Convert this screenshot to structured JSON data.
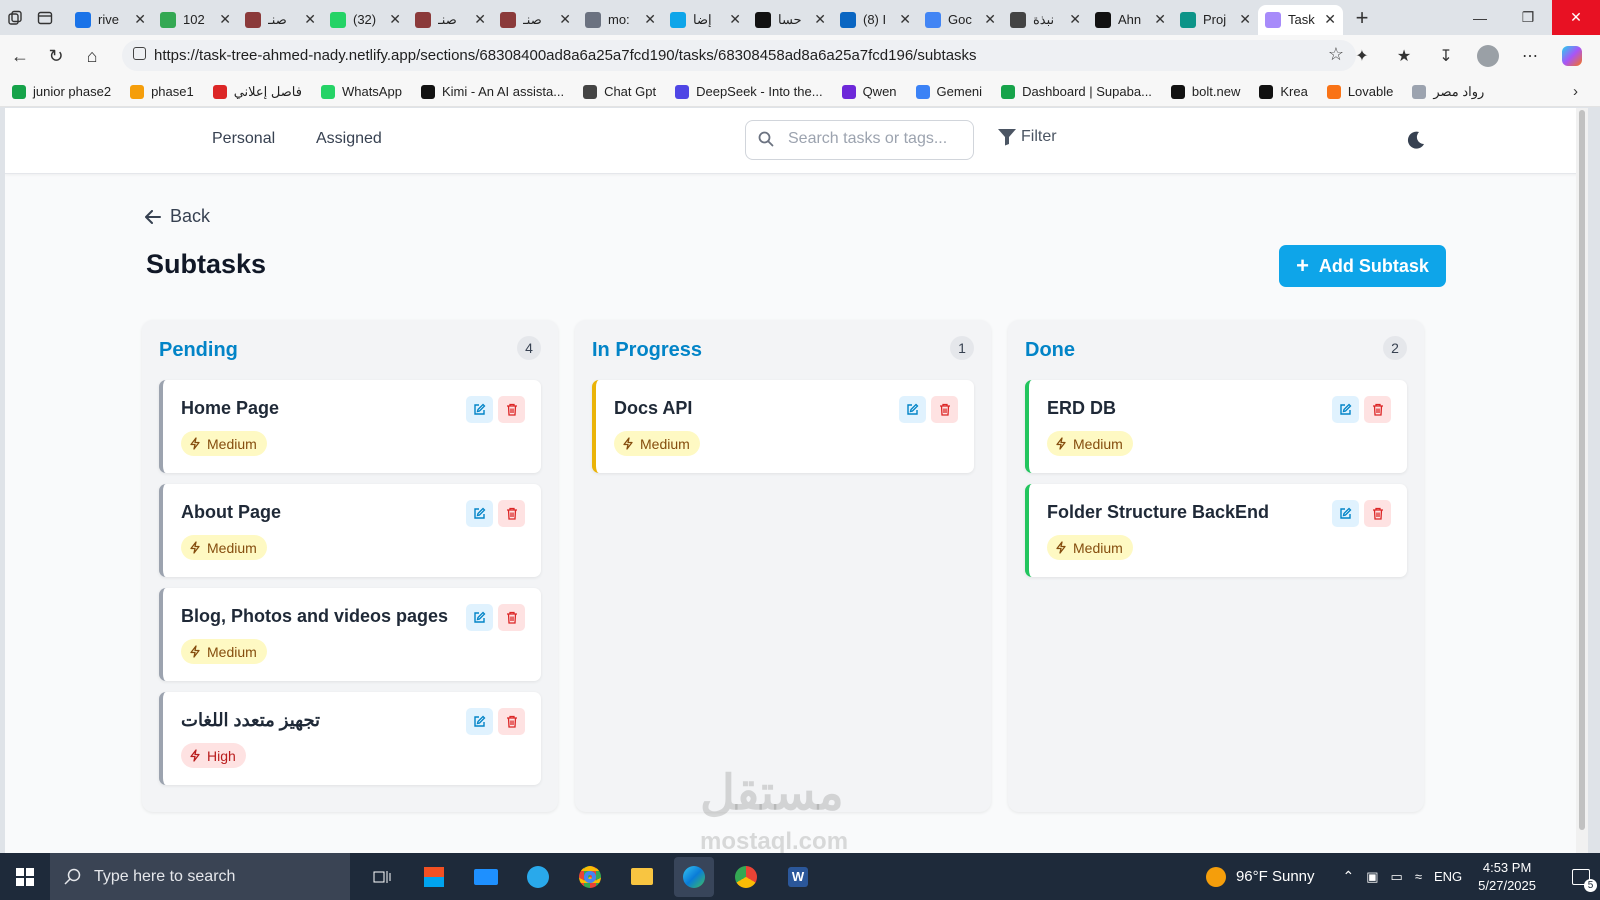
{
  "browser": {
    "tabs": [
      {
        "title": "rive",
        "color": "#1a73e8"
      },
      {
        "title": "102",
        "color": "#34a853"
      },
      {
        "title": "صنـ",
        "color": "#8b3a3a"
      },
      {
        "title": "(32)",
        "color": "#25d366"
      },
      {
        "title": "صنـ",
        "color": "#8b3a3a"
      },
      {
        "title": "صنـ",
        "color": "#8b3a3a"
      },
      {
        "title": "mo:",
        "color": "#6b7280"
      },
      {
        "title": "إضا",
        "color": "#0ea5e9"
      },
      {
        "title": "حسا",
        "color": "#111111"
      },
      {
        "title": "(8) I",
        "color": "#0a66c2"
      },
      {
        "title": "Goc",
        "color": "#4285f4"
      },
      {
        "title": "نبذة",
        "color": "#444444"
      },
      {
        "title": "Ahn",
        "color": "#111111"
      },
      {
        "title": "Proj",
        "color": "#0d9488"
      },
      {
        "title": "Task",
        "color": "#a78bfa",
        "active": true
      }
    ],
    "url": "https://task-tree-ahmed-nady.netlify.app/sections/68308400ad8a6a25a7fcd190/tasks/68308458ad8a6a25a7fcd196/subtasks",
    "bookmarks": [
      {
        "label": "junior phase2",
        "color": "#16a34a"
      },
      {
        "label": "phase1",
        "color": "#f59e0b"
      },
      {
        "label": "فاصل إعلاني",
        "color": "#dc2626"
      },
      {
        "label": "WhatsApp",
        "color": "#25d366"
      },
      {
        "label": "Kimi - An AI assista...",
        "color": "#111111"
      },
      {
        "label": "Chat Gpt",
        "color": "#444444"
      },
      {
        "label": "DeepSeek - Into the...",
        "color": "#4f46e5"
      },
      {
        "label": "Qwen",
        "color": "#6d28d9"
      },
      {
        "label": "Gemeni",
        "color": "#3b82f6"
      },
      {
        "label": "Dashboard | Supaba...",
        "color": "#16a34a"
      },
      {
        "label": "bolt.new",
        "color": "#111111"
      },
      {
        "label": "Krea",
        "color": "#111111"
      },
      {
        "label": "Lovable",
        "color": "#f97316"
      },
      {
        "label": "رواد مصر",
        "color": "#9ca3af"
      }
    ]
  },
  "header": {
    "nav": [
      "Personal",
      "Assigned"
    ],
    "search_placeholder": "Search tasks or tags...",
    "filter_label": "Filter"
  },
  "page": {
    "back_label": "Back",
    "title": "Subtasks",
    "add_button": "Add Subtask"
  },
  "columns": [
    {
      "title": "Pending",
      "count": "4",
      "accent": "#9ca3af",
      "cards": [
        {
          "title": "Home Page",
          "priority": "Medium"
        },
        {
          "title": "About Page",
          "priority": "Medium"
        },
        {
          "title": "Blog, Photos and videos pages",
          "priority": "Medium"
        },
        {
          "title": "تجهيز متعدد اللغات",
          "priority": "High"
        }
      ]
    },
    {
      "title": "In Progress",
      "count": "1",
      "accent": "#eab308",
      "cards": [
        {
          "title": "Docs API",
          "priority": "Medium"
        }
      ]
    },
    {
      "title": "Done",
      "count": "2",
      "accent": "#22c55e",
      "cards": [
        {
          "title": "ERD DB",
          "priority": "Medium"
        },
        {
          "title": "Folder Structure BackEnd",
          "priority": "Medium"
        }
      ]
    }
  ],
  "watermark": {
    "text1": "مستقل",
    "text2": "mostaql.com"
  },
  "taskbar": {
    "search_placeholder": "Type here to search",
    "weather": "96°F  Sunny",
    "language": "ENG",
    "time": "4:53 PM",
    "date": "5/27/2025",
    "notifications": "5"
  }
}
